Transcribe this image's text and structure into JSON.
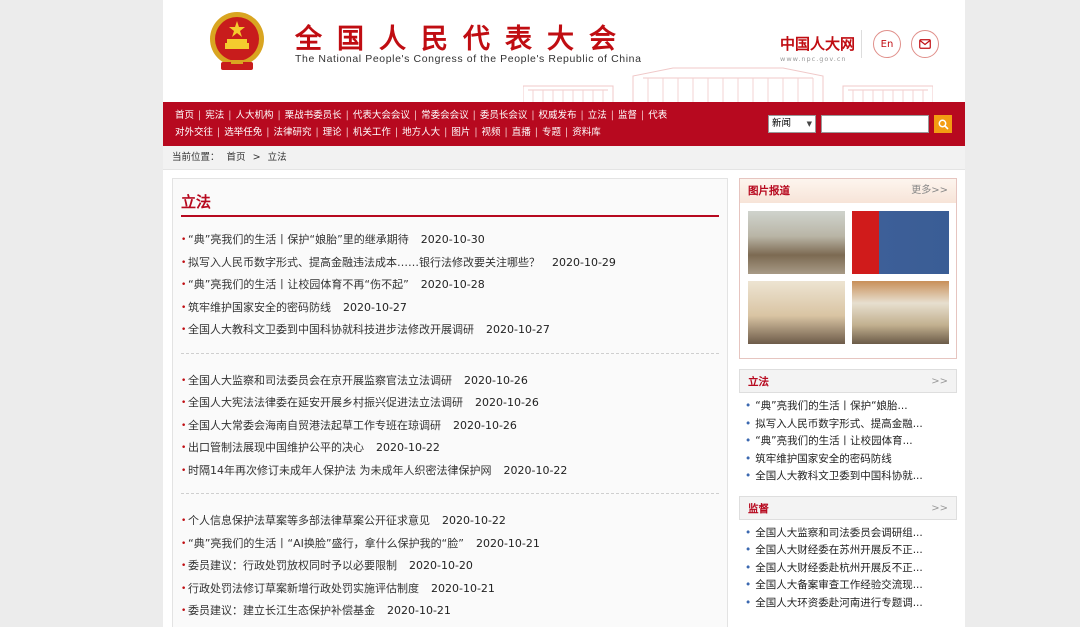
{
  "header": {
    "title_cn": "全国人民代表大会",
    "title_en": "The National People's Congress of the People's Republic of China",
    "site_logo": "中国人大网",
    "site_url": "www.npc.gov.cn",
    "lang_button": "En",
    "mail_icon": "mail-icon",
    "emblem_icon": "national-emblem-icon"
  },
  "nav": {
    "row1": [
      "首页",
      "宪法",
      "人大机构",
      "栗战书委员长",
      "代表大会会议",
      "常委会会议",
      "委员长会议",
      "权威发布",
      "立法",
      "监督",
      "代表"
    ],
    "row2": [
      "对外交往",
      "选举任免",
      "法律研究",
      "理论",
      "机关工作",
      "地方人大",
      "图片",
      "视频",
      "直播",
      "专题",
      "资料库"
    ]
  },
  "search": {
    "select_value": "新闻",
    "input_value": "",
    "button_icon": "search-icon"
  },
  "breadcrumb": {
    "prefix": "当前位置：",
    "home": "首页",
    "sep": ">",
    "current": "立法"
  },
  "main": {
    "title": "立法",
    "groups": [
      [
        {
          "title": "“典”亮我们的生活丨保护“娘胎”里的继承期待",
          "date": "2020-10-30"
        },
        {
          "title": "拟写入人民币数字形式、提高金融违法成本……银行法修改要关注哪些？",
          "date": "2020-10-29"
        },
        {
          "title": "“典”亮我们的生活丨让校园体育不再“伤不起”",
          "date": "2020-10-28"
        },
        {
          "title": "筑牢维护国家安全的密码防线",
          "date": "2020-10-27"
        },
        {
          "title": "全国人大教科文卫委到中国科协就科技进步法修改开展调研",
          "date": "2020-10-27"
        }
      ],
      [
        {
          "title": "全国人大监察和司法委员会在京开展监察官法立法调研",
          "date": "2020-10-26"
        },
        {
          "title": "全国人大宪法法律委在延安开展乡村振兴促进法立法调研",
          "date": "2020-10-26"
        },
        {
          "title": "全国人大常委会海南自贸港法起草工作专班在琼调研",
          "date": "2020-10-26"
        },
        {
          "title": "出口管制法展现中国维护公平的决心",
          "date": "2020-10-22"
        },
        {
          "title": "时隔14年再次修订未成年人保护法 为未成年人织密法律保护网",
          "date": "2020-10-22"
        }
      ],
      [
        {
          "title": "个人信息保护法草案等多部法律草案公开征求意见",
          "date": "2020-10-22"
        },
        {
          "title": "“典”亮我们的生活丨“AI换脸”盛行，拿什么保护我的“脸”",
          "date": "2020-10-21"
        },
        {
          "title": "委员建议：行政处罚放权同时予以必要限制",
          "date": "2020-10-20"
        },
        {
          "title": "行政处罚法修订草案新增行政处罚实施评估制度",
          "date": "2020-10-21"
        },
        {
          "title": "委员建议：建立长江生态保护补偿基金",
          "date": "2020-10-21"
        }
      ]
    ]
  },
  "sidebar": {
    "pic_title": "图片报道",
    "pic_more": "更多>>",
    "box1_title": "立法",
    "box1_more": ">>",
    "box1_items": [
      "“典”亮我们的生活丨保护“娘胎...",
      "拟写入人民币数字形式、提高金融...",
      "“典”亮我们的生活丨让校园体育...",
      "筑牢维护国家安全的密码防线",
      "全国人大教科文卫委到中国科协就..."
    ],
    "box2_title": "监督",
    "box2_more": ">>",
    "box2_items": [
      "全国人大监察和司法委员会调研组...",
      "全国人大财经委在苏州开展反不正...",
      "全国人大财经委赴杭州开展反不正...",
      "全国人大备案审查工作经验交流现...",
      "全国人大环资委赴河南进行专题调..."
    ]
  },
  "colors": {
    "brand_red": "#b7091f",
    "accent_orange": "#f39c12",
    "link_blue": "#3b68b0"
  }
}
